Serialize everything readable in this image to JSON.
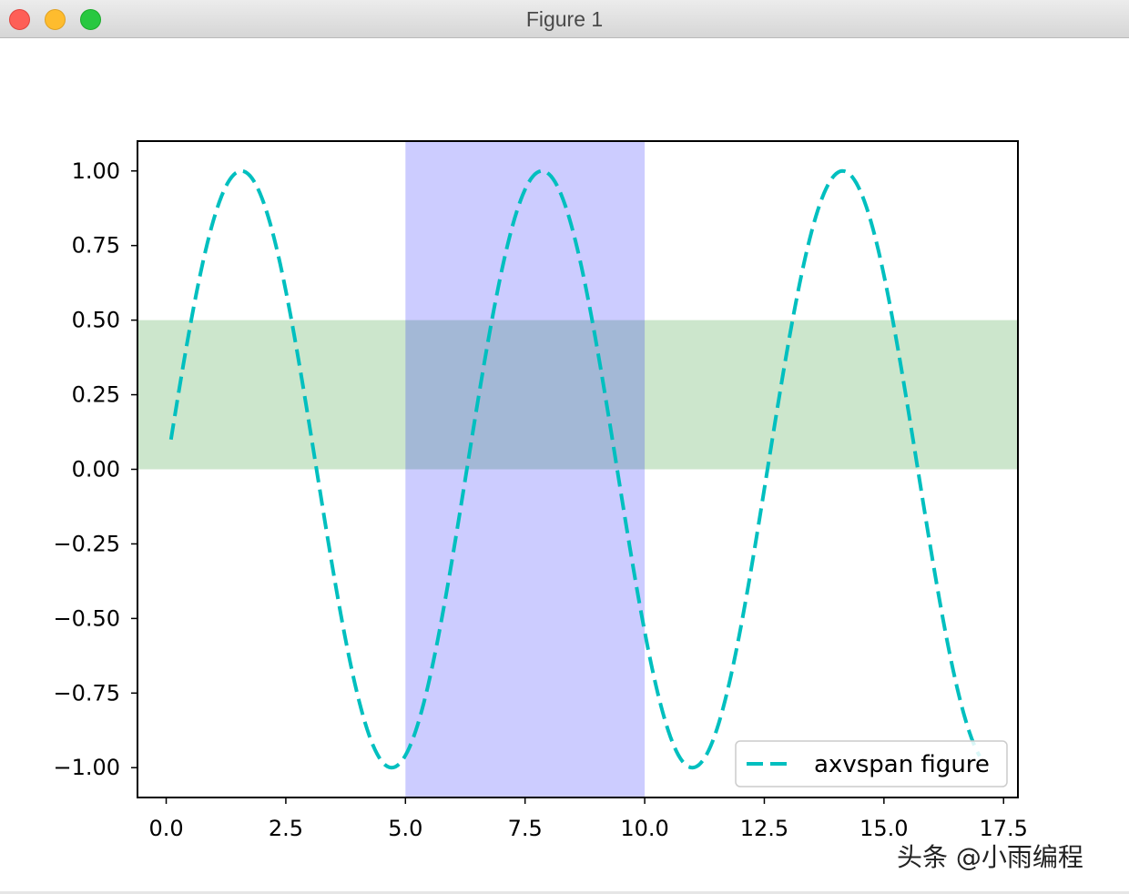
{
  "window": {
    "title": "Figure 1",
    "buttons": [
      "close",
      "minimize",
      "zoom"
    ]
  },
  "watermark": "头条 @小雨编程",
  "chart_data": {
    "type": "line",
    "title": "",
    "xlabel": "",
    "ylabel": "",
    "xlim": [
      -0.6,
      17.8
    ],
    "ylim": [
      -1.1,
      1.1
    ],
    "xticks": [
      0.0,
      2.5,
      5.0,
      7.5,
      10.0,
      12.5,
      15.0,
      17.5
    ],
    "xtick_labels": [
      "0.0",
      "2.5",
      "5.0",
      "7.5",
      "10.0",
      "12.5",
      "15.0",
      "17.5"
    ],
    "yticks": [
      1.0,
      0.75,
      0.5,
      0.25,
      0.0,
      -0.25,
      -0.5,
      -0.75,
      -1.0
    ],
    "ytick_labels": [
      "1.00",
      "0.75",
      "0.50",
      "0.25",
      "0.00",
      "−0.25",
      "−0.50",
      "−0.75",
      "−1.00"
    ],
    "grid": false,
    "legend_position": "lower-right",
    "spans": [
      {
        "orientation": "vertical",
        "from": 5.0,
        "to": 10.0,
        "color": "#0000ff",
        "alpha": 0.2
      },
      {
        "orientation": "horizontal",
        "from": 0.0,
        "to": 0.5,
        "color": "#008000",
        "alpha": 0.2
      }
    ],
    "series": [
      {
        "name": "axvspan figure",
        "function": "sin(x)",
        "color": "#00bfbf",
        "linestyle": "dashed",
        "x": [
          0.1,
          0.5,
          1.0,
          1.5,
          2.0,
          2.5,
          3.0,
          3.5,
          4.0,
          4.5,
          5.0,
          5.5,
          6.0,
          6.5,
          7.0,
          7.5,
          8.0,
          8.5,
          9.0,
          9.5,
          10.0,
          10.5,
          11.0,
          11.5,
          12.0,
          12.5,
          13.0,
          13.5,
          14.0,
          14.5,
          15.0,
          15.5,
          16.0,
          16.5,
          17.0
        ],
        "y": [
          0.1,
          0.48,
          0.84,
          1.0,
          0.91,
          0.6,
          0.14,
          -0.35,
          -0.76,
          -0.98,
          -0.96,
          -0.71,
          -0.28,
          0.22,
          0.66,
          0.94,
          0.99,
          0.8,
          0.41,
          -0.08,
          -0.54,
          -0.88,
          -1.0,
          -0.88,
          -0.54,
          -0.07,
          0.42,
          0.8,
          0.99,
          0.93,
          0.65,
          0.2,
          -0.29,
          -0.71,
          -0.96
        ]
      }
    ]
  }
}
